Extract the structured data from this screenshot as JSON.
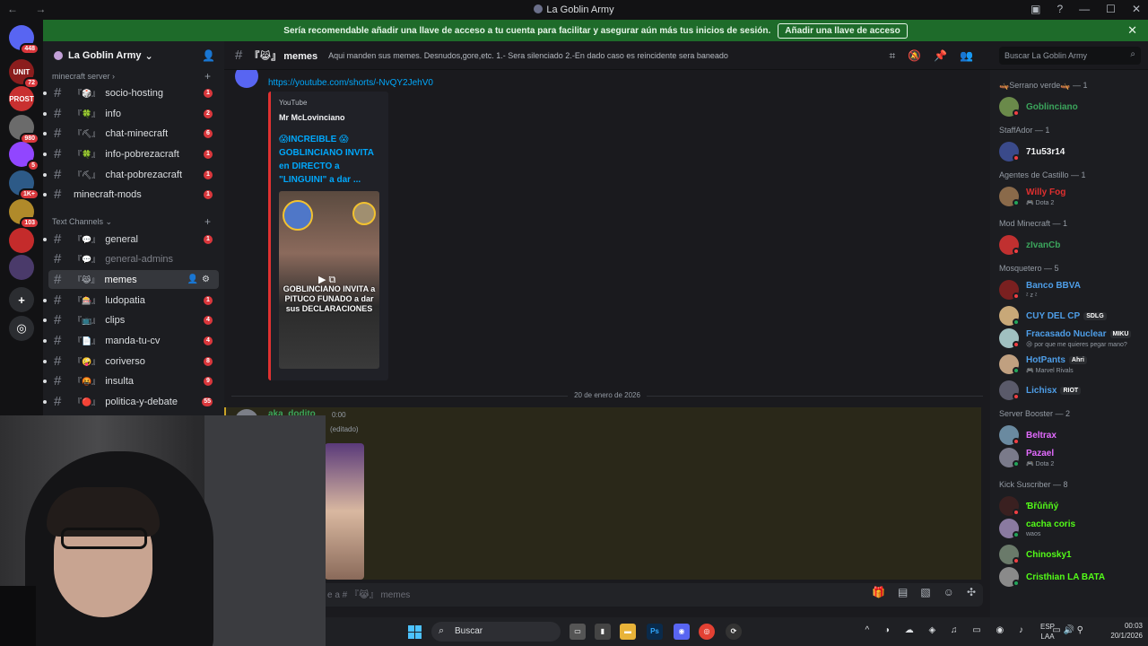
{
  "window": {
    "title": "La Goblin Army",
    "nav": "← →"
  },
  "notice": {
    "text": "Sería recomendable añadir una llave de acceso a tu cuenta para facilitar y asegurar aún más tus inicios de sesión.",
    "button": "Añadir una llave de acceso"
  },
  "guilds": [
    {
      "label": "",
      "badge": "448",
      "color": "#5865f2"
    },
    {
      "label": "UNIT",
      "badge": "72",
      "color": "#8b1d1d"
    },
    {
      "label": "PROST",
      "badge": "",
      "color": "#c93030"
    },
    {
      "label": "",
      "badge": "980",
      "color": "#6b6b6b"
    },
    {
      "label": "",
      "badge": "5",
      "color": "#9146ff"
    },
    {
      "label": "",
      "badge": "1K+",
      "color": "#2d5a87"
    },
    {
      "label": "",
      "badge": "103",
      "color": "#b08a2a"
    },
    {
      "label": "",
      "badge": "",
      "color": "#c42b2b"
    },
    {
      "label": "",
      "badge": "",
      "color": "#4a3a6a"
    }
  ],
  "server": {
    "name": "La Goblin Army"
  },
  "categories": {
    "minecraft": "minecraft server",
    "text": "Text Channels"
  },
  "channels": [
    {
      "emoji": "『🎲』",
      "name": "socio-hosting",
      "count": "1"
    },
    {
      "emoji": "『🍀』",
      "name": "info",
      "count": "2"
    },
    {
      "emoji": "『⛏』",
      "name": "chat-minecraft",
      "count": "6"
    },
    {
      "emoji": "『🍀』",
      "name": "info-pobrezacraft",
      "count": "1"
    },
    {
      "emoji": "『⛏』",
      "name": "chat-pobrezacraft",
      "count": "1"
    },
    {
      "emoji": "",
      "name": "minecraft-mods",
      "count": "1"
    },
    {
      "emoji": "『💬』",
      "name": "general",
      "count": "1"
    },
    {
      "emoji": "『💬』",
      "name": "general-admins",
      "count": ""
    },
    {
      "emoji": "『😹』",
      "name": "memes",
      "count": ""
    },
    {
      "emoji": "『🎰』",
      "name": "ludopatia",
      "count": "1"
    },
    {
      "emoji": "『📺』",
      "name": "clips",
      "count": "4"
    },
    {
      "emoji": "『📄』",
      "name": "manda-tu-cv",
      "count": "4"
    },
    {
      "emoji": "『🤪』",
      "name": "coriverso",
      "count": "8"
    },
    {
      "emoji": "『🤬』",
      "name": "insulta",
      "count": "9"
    },
    {
      "emoji": "『🔴』",
      "name": "politica-y-debate",
      "count": "55"
    }
  ],
  "header": {
    "channel": "『😹』 memes",
    "topic": "Aqui manden sus memes. Desnudos,gore,etc. 1.- Sera silenciado 2.-En dado caso es reincidente sera baneado",
    "search_placeholder": "Buscar La Goblin Army"
  },
  "messages": {
    "link": "https://youtube.com/shorts/-NvQY2JehV0",
    "embed_provider": "YouTube",
    "embed_author": "Mr McLovinciano",
    "embed_title": "😱INCREIBLE 😱 GOBLINCIANO INVITA en DIRECTO a \"LINGUINI\" a dar ...",
    "thumb_caption": "GOBLINCIANO INVITA a PITUCO FUNADO a dar sus DECLARACIONES",
    "date_divider": "20 de enero de 2026",
    "user2": "aka_dodito",
    "time2": "0:00",
    "edited": "(editado)"
  },
  "composer": {
    "placeholder": "e a # 『😹』 memes"
  },
  "members": {
    "groups": [
      {
        "title": "🛶Serrano verde🛶 — 1",
        "members": [
          {
            "name": "Goblinciano",
            "color": "#3ba55c",
            "sub": "",
            "tag": ""
          }
        ]
      },
      {
        "title": "StaffAdor — 1",
        "members": [
          {
            "name": "71u53r14",
            "color": "#f2f3f5",
            "sub": "",
            "tag": ""
          }
        ]
      },
      {
        "title": "Agentes de Castillo — 1",
        "members": [
          {
            "name": "Willy Fog",
            "color": "#e02f2f",
            "sub": "🎮 Dota 2",
            "tag": ""
          }
        ]
      },
      {
        "title": "Mod Minecraft — 1",
        "members": [
          {
            "name": "zIvanCb",
            "color": "#3ba55c",
            "sub": "",
            "tag": ""
          }
        ]
      },
      {
        "title": "Mosquetero — 5",
        "members": [
          {
            "name": "Banco BBVA",
            "color": "#4e9ee8",
            "sub": "ᶻ z ᶻ",
            "tag": ""
          },
          {
            "name": "CUY DEL CP",
            "color": "#4e9ee8",
            "sub": "",
            "tag": "SDLG"
          },
          {
            "name": "Fracasado Nuclear",
            "color": "#4e9ee8",
            "sub": "😢 por que me quieres pegar mano?",
            "tag": "MIKU"
          },
          {
            "name": "HotPants",
            "color": "#4e9ee8",
            "sub": "🎮 Marvel Rivals",
            "tag": "Ahri"
          },
          {
            "name": "Lichisx",
            "color": "#4e9ee8",
            "sub": "",
            "tag": "RIOT"
          }
        ]
      },
      {
        "title": "Server Booster — 2",
        "members": [
          {
            "name": "Beltrax",
            "color": "#e36bff",
            "sub": "",
            "tag": ""
          },
          {
            "name": "Pazael",
            "color": "#e36bff",
            "sub": "🎮 Dota 2",
            "tag": ""
          }
        ]
      },
      {
        "title": "Kick Suscriber — 8",
        "members": [
          {
            "name": "Ɓřůňňý",
            "color": "#53fc18",
            "sub": "",
            "tag": ""
          },
          {
            "name": "cacha coris",
            "color": "#53fc18",
            "sub": "waos",
            "tag": ""
          },
          {
            "name": "Chinosky1",
            "color": "#53fc18",
            "sub": "",
            "tag": ""
          },
          {
            "name": "Cristhian LA BATA",
            "color": "#53fc18",
            "sub": "",
            "tag": ""
          }
        ]
      }
    ]
  },
  "taskbar": {
    "search": "Buscar",
    "lang1": "ESP",
    "lang2": "LAA",
    "time": "00:03",
    "date": "20/1/2026"
  }
}
